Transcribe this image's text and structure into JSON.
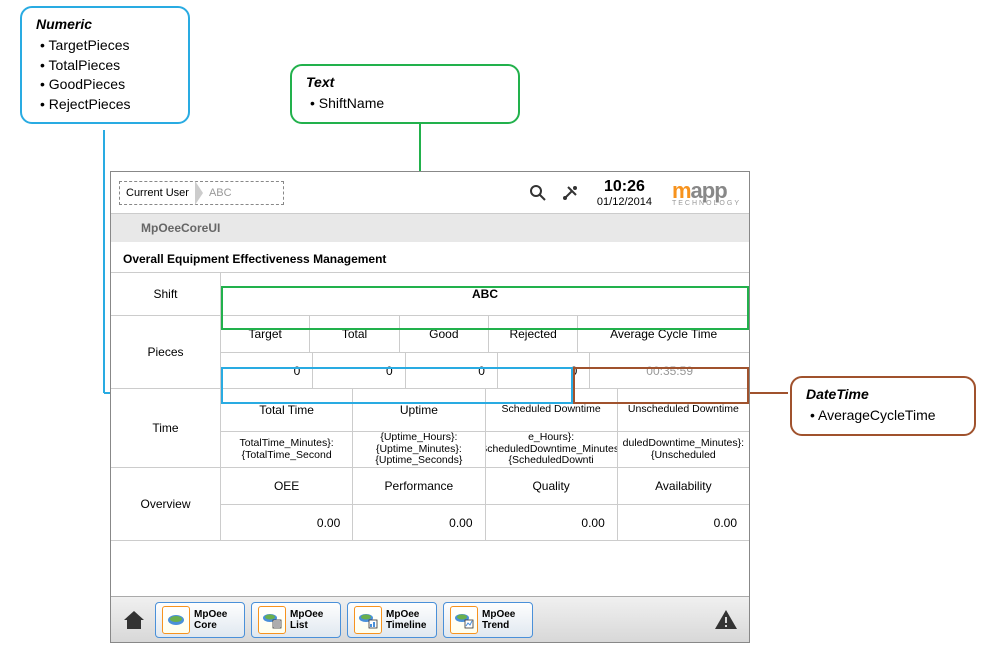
{
  "callouts": {
    "numeric": {
      "title": "Numeric",
      "items": [
        "TargetPieces",
        "TotalPieces",
        "GoodPieces",
        "RejectPieces"
      ]
    },
    "text": {
      "title": "Text",
      "items": [
        "ShiftName"
      ]
    },
    "datetime": {
      "title": "DateTime",
      "items": [
        "AverageCycleTime"
      ]
    }
  },
  "header": {
    "current_user_label": "Current User",
    "current_user_value": "ABC",
    "time": "10:26",
    "date": "01/12/2014",
    "logo_m": "m",
    "logo_app": "app",
    "logo_sub": "TECHNOLOGY"
  },
  "tab": {
    "label": "MpOeeCoreUI"
  },
  "section_title": "Overall Equipment Effectiveness Management",
  "rows": {
    "shift": {
      "label": "Shift",
      "value": "ABC"
    },
    "pieces": {
      "label": "Pieces",
      "headers": [
        "Target",
        "Total",
        "Good",
        "Rejected"
      ],
      "avg_cycle_header": "Average Cycle Time",
      "values": [
        "0",
        "0",
        "0",
        "0"
      ],
      "avg_cycle_value": "00:35:59"
    },
    "time": {
      "label": "Time",
      "headers": [
        "Total Time",
        "Uptime",
        "Scheduled Downtime",
        "Unscheduled Downtime"
      ],
      "values": [
        "TotalTime_Minutes}:{TotalTime_Second",
        "{Uptime_Hours}:{Uptime_Minutes}:{Uptime_Seconds}",
        "e_Hours}:{ScheduledDowntime_Minutes}:{ScheduledDownti",
        "duledDowntime_Minutes}:{Unscheduled"
      ]
    },
    "overview": {
      "label": "Overview",
      "headers": [
        "OEE",
        "Performance",
        "Quality",
        "Availability"
      ],
      "values": [
        "0.00",
        "0.00",
        "0.00",
        "0.00"
      ]
    }
  },
  "bottom_nav": {
    "items": [
      {
        "label": "MpOee Core"
      },
      {
        "label": "MpOee List"
      },
      {
        "label": "MpOee Timeline"
      },
      {
        "label": "MpOee Trend"
      }
    ]
  },
  "colors": {
    "numeric": "#29abe2",
    "text": "#22b14c",
    "datetime": "#a0522d",
    "accent": "#f7931e"
  }
}
